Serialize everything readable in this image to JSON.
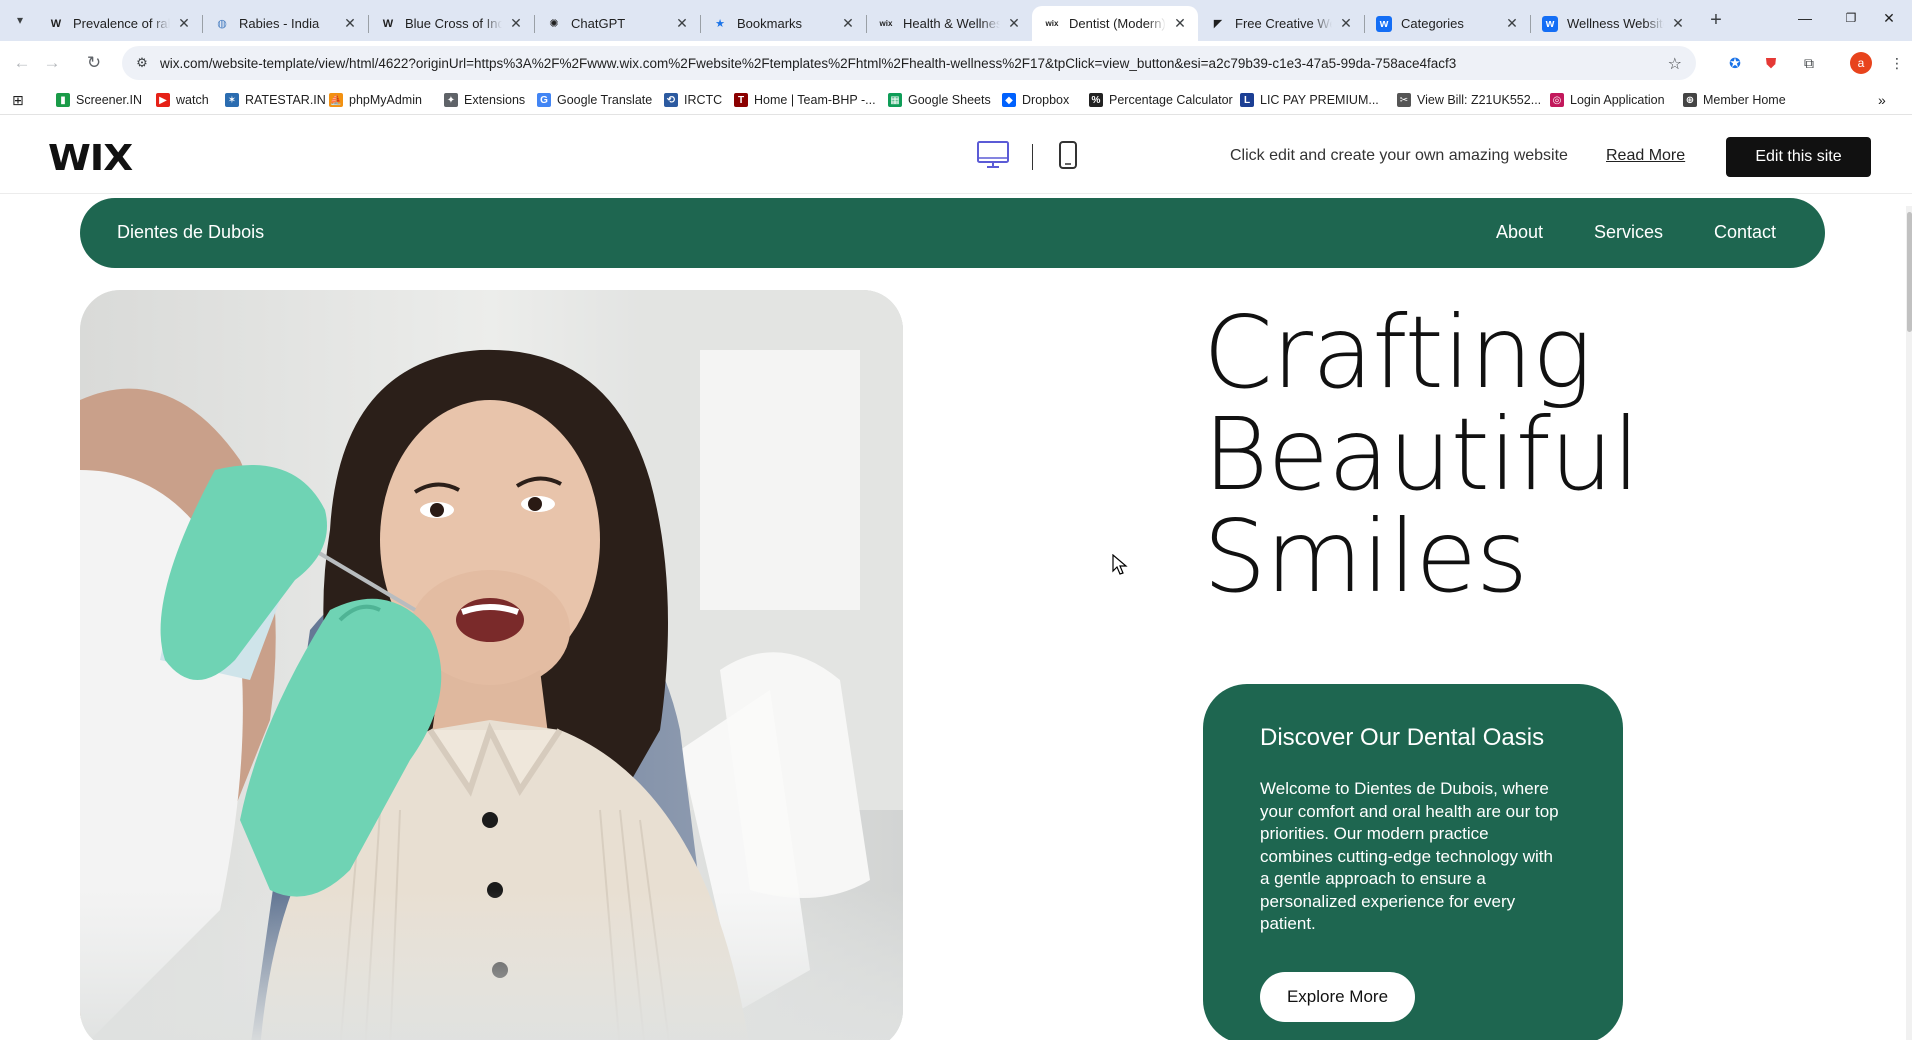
{
  "browser": {
    "tabs": [
      {
        "title": "Prevalence of rab",
        "icon": "W",
        "active": false
      },
      {
        "title": "Rabies - India",
        "icon": "globe",
        "active": false
      },
      {
        "title": "Blue Cross of Indi",
        "icon": "W",
        "active": false
      },
      {
        "title": "ChatGPT",
        "icon": "chatgpt",
        "active": false
      },
      {
        "title": "Bookmarks",
        "icon": "star",
        "active": false
      },
      {
        "title": "Health & Wellnes",
        "icon": "wix",
        "active": false
      },
      {
        "title": "Dentist (Modern)",
        "icon": "wix",
        "active": true
      },
      {
        "title": "Free Creative Wel",
        "icon": "framer",
        "active": false
      },
      {
        "title": "Categories",
        "icon": "webflow",
        "active": false
      },
      {
        "title": "Wellness Website",
        "icon": "webflow",
        "active": false
      }
    ],
    "url": "wix.com/website-template/view/html/4622?originUrl=https%3A%2F%2Fwww.wix.com%2Fwebsite%2Ftemplates%2Fhtml%2Fhealth-wellness%2F17&tpClick=view_button&esi=a2c79b39-c1e3-47a5-99da-758ace4facf3",
    "profile_initial": "a",
    "bookmarks": [
      {
        "label": "Screener.IN",
        "color": "#1a9b48"
      },
      {
        "label": "watch",
        "color": "#e62117"
      },
      {
        "label": "RATESTAR.IN",
        "color": "#2b6cb0"
      },
      {
        "label": "phpMyAdmin",
        "color": "#f29111"
      },
      {
        "label": "Extensions",
        "color": "#5f6368"
      },
      {
        "label": "Google Translate",
        "color": "#4285f4"
      },
      {
        "label": "IRCTC",
        "color": "#2c5aa0"
      },
      {
        "label": "Home | Team-BHP -...",
        "color": "#8b0000"
      },
      {
        "label": "Google Sheets",
        "color": "#0f9d58"
      },
      {
        "label": "Dropbox",
        "color": "#0061fe"
      },
      {
        "label": "Percentage Calculator",
        "color": "#222222"
      },
      {
        "label": "LIC PAY PREMIUM...",
        "color": "#1c3f94"
      },
      {
        "label": "View Bill: Z21UK552...",
        "color": "#555555"
      },
      {
        "label": "Login Application",
        "color": "#c2185b"
      },
      {
        "label": "Member Home",
        "color": "#444444"
      }
    ]
  },
  "wix_bar": {
    "logo": "WIX",
    "promo": "Click edit and create your own amazing website",
    "read_more": "Read More",
    "edit_button": "Edit this site"
  },
  "site": {
    "brand": "Dientes de Dubois",
    "nav": [
      "About",
      "Services",
      "Contact"
    ],
    "headline": [
      "Crafting",
      "Beautiful",
      "Smiles"
    ],
    "card": {
      "title": "Discover Our Dental Oasis",
      "body": "Welcome to Dientes de Dubois, where your comfort and oral health are our top priorities. Our modern practice combines cutting-edge technology with a gentle approach to ensure a personalized experience for every patient.",
      "button": "Explore More"
    },
    "colors": {
      "brand_green": "#1e6650",
      "glove": "#6fd3b4"
    }
  }
}
